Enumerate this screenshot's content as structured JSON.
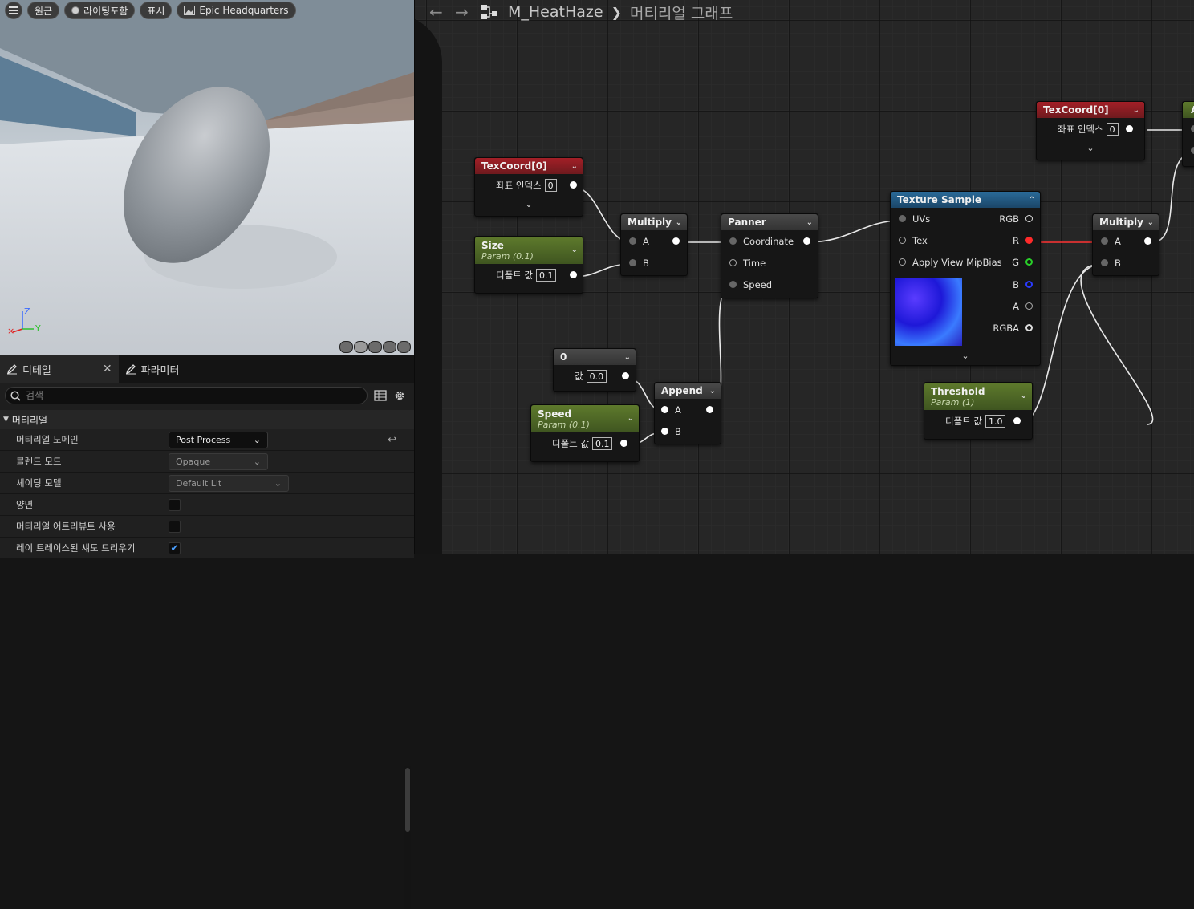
{
  "viewport": {
    "toolbar": {
      "perspective": "원근",
      "lighting": "라이팅포함",
      "show": "표시",
      "preview_scene": "Epic Headquarters"
    },
    "axis": {
      "z": "Z",
      "y": "Y"
    }
  },
  "details": {
    "tabs": [
      {
        "label": "디테일",
        "active": true
      },
      {
        "label": "파라미터",
        "active": false
      }
    ],
    "search_placeholder": "검색",
    "section": "머티리얼",
    "properties": [
      {
        "label": "머티리얼 도메인",
        "value": "Post Process"
      },
      {
        "label": "블렌드 모드",
        "value": "Opaque"
      },
      {
        "label": "셰이딩 모델",
        "value": "Default Lit"
      },
      {
        "label": "양면",
        "checked": false
      },
      {
        "label": "머티리얼 어트리뷰트 사용",
        "checked": false
      },
      {
        "label": "레이 트레이스된 섀도 드리우기",
        "checked": true
      }
    ]
  },
  "graph": {
    "breadcrumb": {
      "asset": "M_HeatHaze",
      "view": "머티리얼 그래프"
    },
    "nodes": {
      "texcoord_a": {
        "title": "TexCoord[0]",
        "row_label": "좌표 인덱스",
        "value": "0"
      },
      "texcoord_b": {
        "title": "TexCoord[0]",
        "row_label": "좌표 인덱스",
        "value": "0"
      },
      "size": {
        "title": "Size",
        "subtitle": "Param (0.1)",
        "row_label": "디폴트 값",
        "value": "0.1"
      },
      "multiply_a": {
        "title": "Multiply",
        "pins": [
          "A",
          "B"
        ]
      },
      "panner": {
        "title": "Panner",
        "pins": [
          "Coordinate",
          "Time",
          "Speed"
        ]
      },
      "texture_sample": {
        "title": "Texture Sample",
        "inputs": [
          "UVs",
          "Tex",
          "Apply View MipBias"
        ],
        "outputs": [
          "RGB",
          "R",
          "G",
          "B",
          "A",
          "RGBA"
        ]
      },
      "multiply_b": {
        "title": "Multiply",
        "pins": [
          "A",
          "B"
        ]
      },
      "constant": {
        "title": "0",
        "row_label": "값",
        "value": "0.0"
      },
      "append": {
        "title": "Append",
        "pins": [
          "A",
          "B"
        ]
      },
      "speed": {
        "title": "Speed",
        "subtitle": "Param (0.1)",
        "row_label": "디폴트 값",
        "value": "0.1"
      },
      "threshold": {
        "title": "Threshold",
        "subtitle": "Param (1)",
        "row_label": "디폴트 값",
        "value": "1.0"
      },
      "partial": {
        "title": "A"
      }
    }
  },
  "colors": {
    "param_header": "#5e7a2c",
    "texcoord_header": "#a31f27",
    "texture_header": "#2a6a98",
    "pin_r": "#ff2a2a",
    "pin_g": "#29d129",
    "pin_b": "#2a3aff"
  }
}
